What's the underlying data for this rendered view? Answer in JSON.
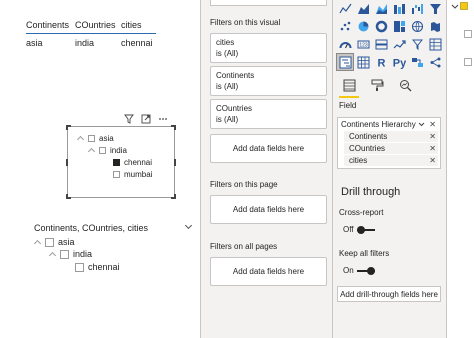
{
  "table": {
    "headers": [
      "Continents",
      "COuntries",
      "cities"
    ],
    "rows": [
      [
        "asia",
        "india",
        "chennai"
      ]
    ]
  },
  "slicer1": {
    "items": [
      {
        "label": "asia"
      },
      {
        "label": "india"
      },
      {
        "label": "chennai"
      },
      {
        "label": "mumbai"
      }
    ]
  },
  "slicer2": {
    "title": "Continents, COuntries, cities",
    "items": [
      {
        "label": "asia"
      },
      {
        "label": "india"
      },
      {
        "label": "chennai"
      }
    ]
  },
  "filters": {
    "visual_title": "Filters on this visual",
    "cards": [
      {
        "name": "cities",
        "state": "is (All)"
      },
      {
        "name": "Continents",
        "state": "is (All)"
      },
      {
        "name": "COuntries",
        "state": "is (All)"
      }
    ],
    "add_fields": "Add data fields here",
    "page_title": "Filters on this page",
    "all_pages_title": "Filters on all pages"
  },
  "viz": {
    "field_label": "Field",
    "hierarchy": "Continents Hierarchy",
    "fields": [
      "Continents",
      "COuntries",
      "cities"
    ],
    "drill_title": "Drill through",
    "cross_report": "Cross-report",
    "cross_report_state": "Off",
    "keep_filters": "Keep all filters",
    "keep_filters_state": "On",
    "add_drill": "Add drill-through fields here"
  },
  "colors": {
    "accent_yellow": "#f2c811",
    "table_rule": "#2b6cb0",
    "pane_bg": "#f3f2f1"
  }
}
